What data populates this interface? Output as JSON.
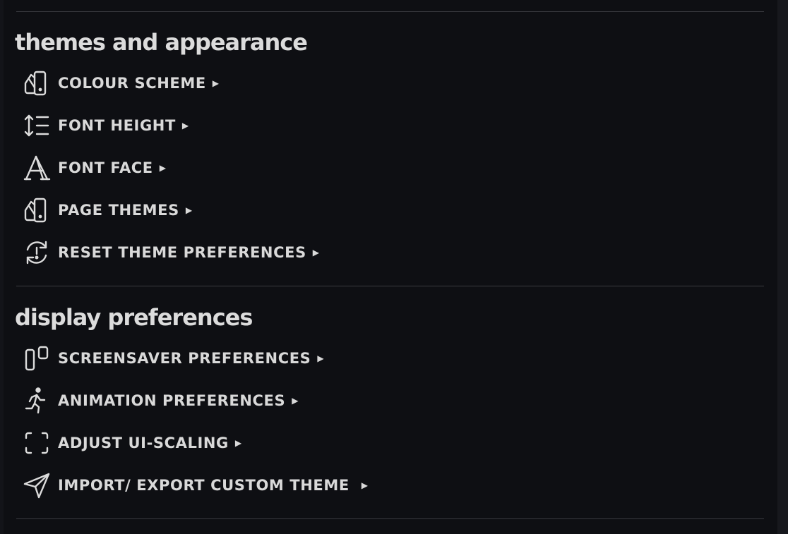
{
  "sections": [
    {
      "title": "themes and appearance",
      "items": [
        {
          "label": "COLOUR SCHEME",
          "arrow": "▶",
          "icon": "swatches-icon"
        },
        {
          "label": "FONT HEIGHT",
          "arrow": "▶",
          "icon": "line-height-icon"
        },
        {
          "label": "FONT FACE",
          "arrow": "▶",
          "icon": "font-letter-icon"
        },
        {
          "label": "PAGE THEMES",
          "arrow": "▶",
          "icon": "swatches-icon"
        },
        {
          "label": "RESET THEME PREFERENCES",
          "arrow": "▶",
          "icon": "reset-alert-icon"
        }
      ]
    },
    {
      "title": "display preferences",
      "items": [
        {
          "label": "SCREENSAVER PREFERENCES",
          "arrow": "▶",
          "icon": "screensaver-icon"
        },
        {
          "label": "ANIMATION PREFERENCES",
          "arrow": "▶",
          "icon": "running-person-icon"
        },
        {
          "label": "ADJUST UI-SCALING",
          "arrow": "▶",
          "icon": "scaling-frame-icon"
        },
        {
          "label": "IMPORT/ EXPORT CUSTOM THEME ",
          "arrow": "▶",
          "icon": "send-plane-icon"
        }
      ]
    }
  ],
  "colors": {
    "background": "#0e0f13",
    "text": "#d9d9d9",
    "divider": "#3a3b40"
  }
}
